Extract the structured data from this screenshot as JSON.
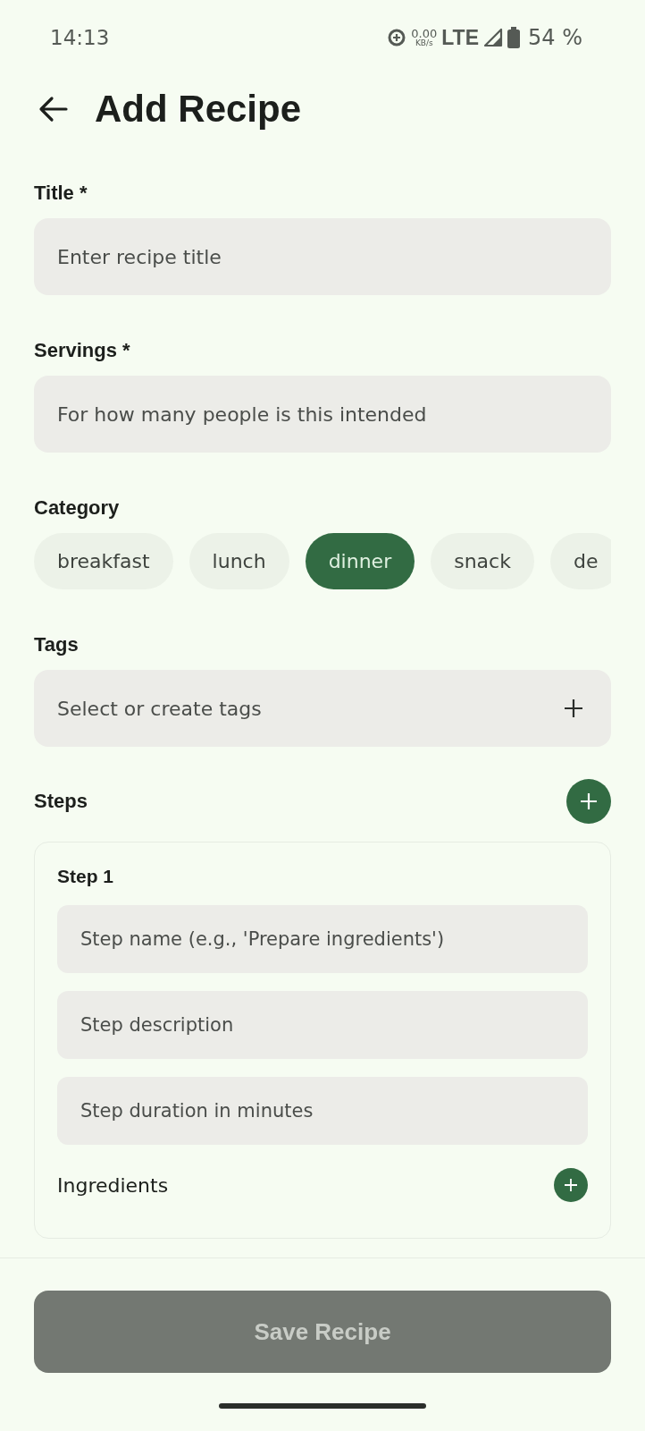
{
  "status_bar": {
    "time": "14:13",
    "speed_value": "0.00",
    "speed_unit": "KB/s",
    "network": "LTE",
    "battery": "54 %"
  },
  "header": {
    "title": "Add Recipe"
  },
  "fields": [
    {
      "label": "Title *",
      "placeholder": "Enter recipe title"
    },
    {
      "label": "Servings *",
      "placeholder": "For how many people is this intended"
    }
  ],
  "category": {
    "label": "Category",
    "chips": [
      {
        "label": "breakfast",
        "selected": false
      },
      {
        "label": "lunch",
        "selected": false
      },
      {
        "label": "dinner",
        "selected": true
      },
      {
        "label": "snack",
        "selected": false
      },
      {
        "label": "de",
        "selected": false
      }
    ]
  },
  "tags": {
    "label": "Tags",
    "placeholder": "Select or create tags"
  },
  "steps": {
    "label": "Steps",
    "items": [
      {
        "title": "Step 1",
        "fields": [
          {
            "placeholder": "Step name (e.g., 'Prepare ingredients')"
          },
          {
            "placeholder": "Step description"
          },
          {
            "placeholder": "Step duration in minutes"
          }
        ],
        "ingredients_label": "Ingredients"
      }
    ]
  },
  "save_button": {
    "label": "Save Recipe",
    "disabled": true
  }
}
